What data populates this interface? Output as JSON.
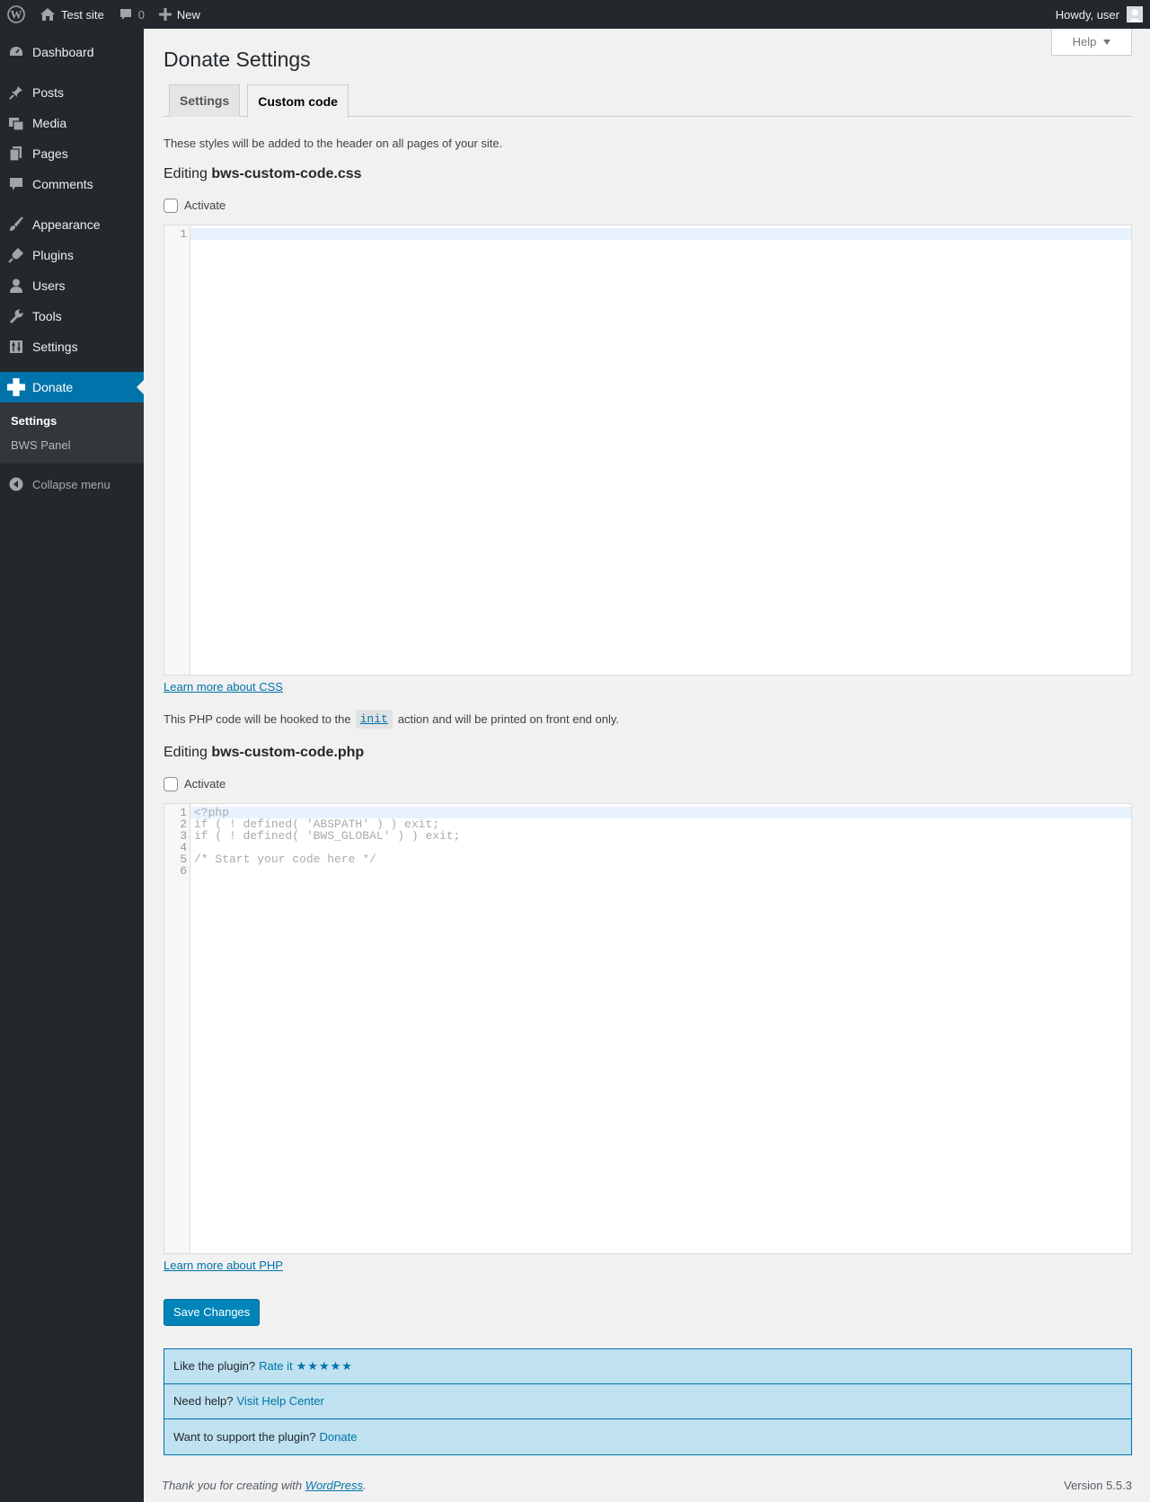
{
  "adminbar": {
    "site_name": "Test site",
    "comments_count": "0",
    "new_label": "New",
    "howdy": "Howdy, user"
  },
  "sidebar": {
    "items": [
      {
        "label": "Dashboard",
        "icon": "dashboard-icon"
      },
      {
        "label": "Posts",
        "icon": "pin-icon"
      },
      {
        "label": "Media",
        "icon": "media-icon"
      },
      {
        "label": "Pages",
        "icon": "page-icon"
      },
      {
        "label": "Comments",
        "icon": "comment-icon"
      },
      {
        "label": "Appearance",
        "icon": "brush-icon"
      },
      {
        "label": "Plugins",
        "icon": "plugin-icon"
      },
      {
        "label": "Users",
        "icon": "user-icon"
      },
      {
        "label": "Tools",
        "icon": "wrench-icon"
      },
      {
        "label": "Settings",
        "icon": "settings-icon"
      },
      {
        "label": "Donate",
        "icon": "plus-icon"
      }
    ],
    "submenu": [
      {
        "label": "Settings"
      },
      {
        "label": "BWS Panel"
      }
    ],
    "collapse_label": "Collapse menu"
  },
  "help_label": "Help",
  "page_title": "Donate Settings",
  "tabs": [
    {
      "label": "Settings"
    },
    {
      "label": "Custom code"
    }
  ],
  "css_section": {
    "description": "These styles will be added to the header on all pages of your site.",
    "editing_prefix": "Editing",
    "filename": "bws-custom-code.css",
    "activate_label": "Activate",
    "lines": [
      "1"
    ],
    "learn_more": "Learn more about CSS"
  },
  "php_section": {
    "desc_before": "This PHP code will be hooked to the",
    "hook": "init",
    "desc_after": "action and will be printed on front end only.",
    "editing_prefix": "Editing",
    "filename": "bws-custom-code.php",
    "activate_label": "Activate",
    "code_lines": [
      "<?php",
      "if ( ! defined( 'ABSPATH' ) ) exit;",
      "if ( ! defined( 'BWS_GLOBAL' ) ) exit;",
      "",
      "/* Start your code here */",
      ""
    ],
    "learn_more": "Learn more about PHP"
  },
  "save_label": "Save Changes",
  "notices": {
    "rate_text": "Like the plugin?",
    "rate_link": "Rate it",
    "stars": "★★★★★",
    "help_text": "Need help?",
    "help_link": "Visit Help Center",
    "support_text": "Want to support the plugin?",
    "support_link": "Donate"
  },
  "footer": {
    "thanks_before": "Thank you for creating with",
    "thanks_link": "WordPress",
    "thanks_after": ".",
    "version": "Version 5.5.3"
  },
  "colors": {
    "adminbar_bg": "#23282d",
    "accent": "#0073aa",
    "notice_bg": "#bfe1f0"
  }
}
